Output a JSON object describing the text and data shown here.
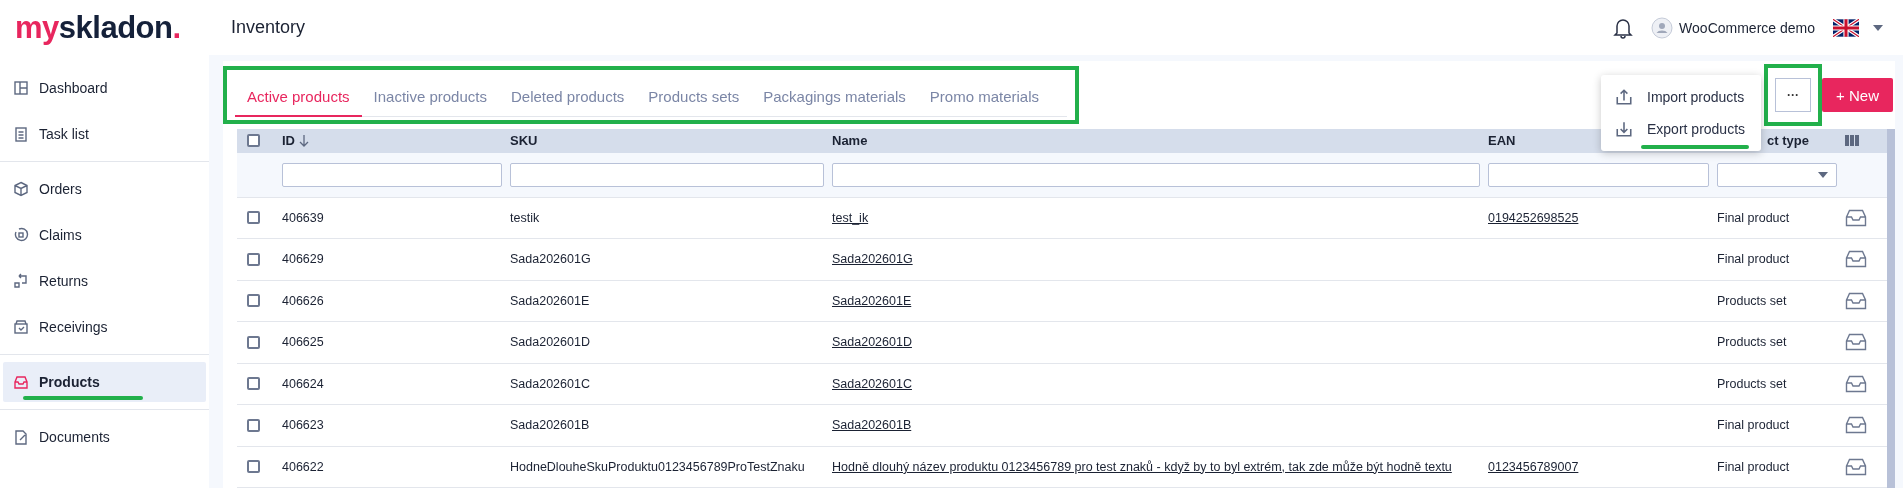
{
  "header": {
    "logo": [
      {
        "text": "my",
        "kind": "accent"
      },
      {
        "text": "skladon",
        "kind": "plain"
      },
      {
        "text": ".",
        "kind": "accent"
      }
    ],
    "title": "Inventory",
    "user": "WooCommerce demo"
  },
  "sidebar": {
    "groups": [
      [
        {
          "label": "Dashboard",
          "kind": "dashboard",
          "selected": false,
          "annotated": false
        },
        {
          "label": "Task list",
          "kind": "tasks",
          "selected": false,
          "annotated": false
        }
      ],
      [
        {
          "label": "Orders",
          "kind": "orders",
          "selected": false,
          "annotated": false
        },
        {
          "label": "Claims",
          "kind": "claims",
          "selected": false,
          "annotated": false
        },
        {
          "label": "Returns",
          "kind": "returns",
          "selected": false,
          "annotated": false
        },
        {
          "label": "Receivings",
          "kind": "receivings",
          "selected": false,
          "annotated": false
        }
      ],
      [
        {
          "label": "Products",
          "kind": "products",
          "selected": true,
          "annotated": true
        }
      ],
      [
        {
          "label": "Documents",
          "kind": "documents",
          "selected": false,
          "annotated": false
        }
      ]
    ]
  },
  "tabs": {
    "annotated": true,
    "items": [
      {
        "label": "Active products",
        "selected": true
      },
      {
        "label": "Inactive products",
        "selected": false
      },
      {
        "label": "Deleted products",
        "selected": false
      },
      {
        "label": "Products sets",
        "selected": false
      },
      {
        "label": "Packagings materials",
        "selected": false
      },
      {
        "label": "Promo materials",
        "selected": false
      }
    ]
  },
  "more_button": {
    "label": "···",
    "annotated": true
  },
  "new_button": {
    "label": "+ New"
  },
  "menu": {
    "items": [
      {
        "label": "Import products",
        "kind": "upload",
        "annotated": false
      },
      {
        "label": "Export products",
        "kind": "download",
        "annotated": true
      }
    ]
  },
  "table": {
    "all_checked": false,
    "columns": [
      {
        "label": "ID",
        "sorted": true,
        "kind": "text"
      },
      {
        "label": "SKU",
        "sorted": false,
        "kind": "text"
      },
      {
        "label": "Name",
        "sorted": false,
        "kind": "text"
      },
      {
        "label": "EAN",
        "sorted": false,
        "kind": "text"
      },
      {
        "label": "ct type",
        "sorted": false,
        "kind": "select"
      }
    ],
    "rows": [
      {
        "checked": false,
        "id": "406639",
        "sku": "testik",
        "name": "test_ik",
        "ean": "0194252698525",
        "type": "Final product"
      },
      {
        "checked": false,
        "id": "406629",
        "sku": "Sada202601G",
        "name": "Sada202601G",
        "ean": "",
        "type": "Final product"
      },
      {
        "checked": false,
        "id": "406626",
        "sku": "Sada202601E",
        "name": "Sada202601E",
        "ean": "",
        "type": "Products set"
      },
      {
        "checked": false,
        "id": "406625",
        "sku": "Sada202601D",
        "name": "Sada202601D",
        "ean": "",
        "type": "Products set"
      },
      {
        "checked": false,
        "id": "406624",
        "sku": "Sada202601C",
        "name": "Sada202601C",
        "ean": "",
        "type": "Products set"
      },
      {
        "checked": false,
        "id": "406623",
        "sku": "Sada202601B",
        "name": "Sada202601B",
        "ean": "",
        "type": "Final product"
      },
      {
        "checked": false,
        "id": "406622",
        "sku": "HodneDlouheSkuProduktu0123456789ProTestZnaku",
        "name": "Hodně dlouhý název produktu 0123456789 pro test znaků - když by to byl extrém, tak zde může být hodně textu",
        "ean": "0123456789007",
        "type": "Final product"
      }
    ]
  }
}
